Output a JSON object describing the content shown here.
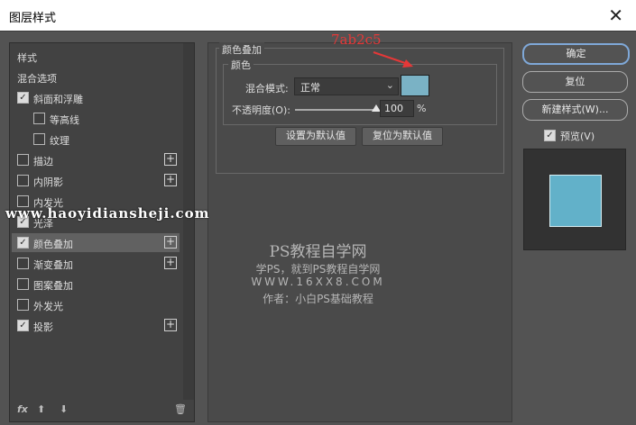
{
  "window": {
    "title": "图层样式",
    "close_label": "✕"
  },
  "styles_panel": {
    "header": "样式",
    "blend_options": "混合选项",
    "items": [
      {
        "label": "斜面和浮雕",
        "checked": true,
        "plus": false
      },
      {
        "label": "等高线",
        "checked": false,
        "plus": false
      },
      {
        "label": "纹理",
        "checked": false,
        "plus": false
      },
      {
        "label": "描边",
        "checked": false,
        "plus": true
      },
      {
        "label": "内阴影",
        "checked": false,
        "plus": true
      },
      {
        "label": "内发光",
        "checked": false,
        "plus": false
      },
      {
        "label": "光泽",
        "checked": true,
        "plus": false
      },
      {
        "label": "颜色叠加",
        "checked": true,
        "plus": true,
        "selected": true
      },
      {
        "label": "渐变叠加",
        "checked": false,
        "plus": true
      },
      {
        "label": "图案叠加",
        "checked": false,
        "plus": false
      },
      {
        "label": "外发光",
        "checked": false,
        "plus": false
      },
      {
        "label": "投影",
        "checked": true,
        "plus": true
      }
    ],
    "footer": {
      "fx": "fx",
      "up": "⬆",
      "down": "⬇",
      "trash": "🗑"
    }
  },
  "color_overlay": {
    "group_title": "颜色叠加",
    "sub_title": "颜色",
    "blend_mode_label": "混合模式:",
    "blend_mode_value": "正常",
    "opacity_label": "不透明度(O):",
    "opacity_value": "100",
    "opacity_unit": "%",
    "opacity_level": 1.0,
    "swatch_color": "#7ab2c5",
    "set_default": "设置为默认值",
    "reset_default": "复位为默认值"
  },
  "annotation": {
    "text": "7ab2c5",
    "color": "#e53838"
  },
  "right_panel": {
    "ok": "确定",
    "reset": "复位",
    "new_style": "新建样式(W)...",
    "preview_label": "预览(V)",
    "preview_checked": true,
    "preview_color": "#62b1c9"
  },
  "watermarks": {
    "site": "www.haoyidiansheji.com",
    "line1": "PS教程自学网",
    "line2": "学PS，就到PS教程自学网",
    "line3": "WWW.16XX8.COM",
    "line4": "作者：小白PS基础教程"
  }
}
